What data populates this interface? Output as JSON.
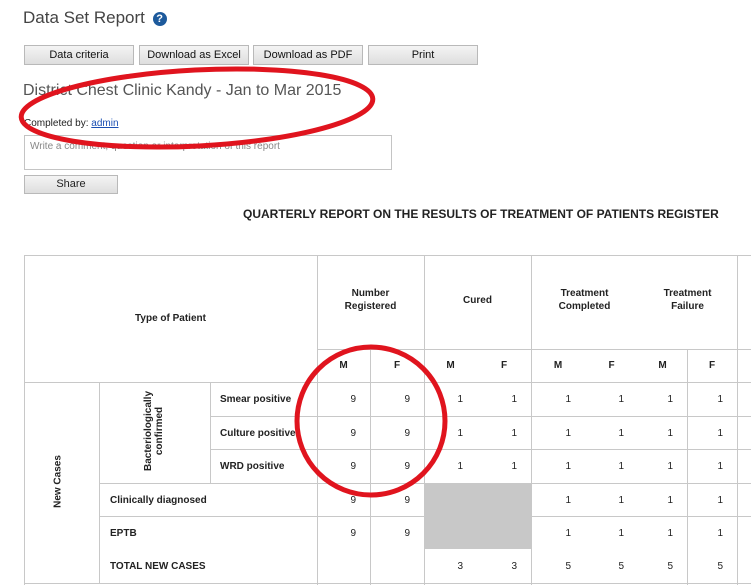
{
  "header": {
    "title": "Data Set Report",
    "help_icon": "?"
  },
  "toolbar": {
    "data_criteria": "Data criteria",
    "download_excel": "Download as Excel",
    "download_pdf": "Download as PDF",
    "print": "Print"
  },
  "report": {
    "title": "District Chest Clinic Kandy - Jan to Mar 2015",
    "completed_by_label": "Completed by:",
    "completed_by_user": "admin"
  },
  "comment": {
    "placeholder": "Write a comment, question or interpretation of this report",
    "share": "Share"
  },
  "table": {
    "title": "QUARTERLY REPORT ON THE RESULTS OF TREATMENT OF PATIENTS REGISTER",
    "type_header": "Type of Patient",
    "group_headers": [
      "Number Registered",
      "Cured",
      "Treatment Completed",
      "Treatment Failure"
    ],
    "sex_headers": [
      "M",
      "F",
      "M",
      "F",
      "M",
      "F",
      "M",
      "F"
    ],
    "new_cases": "New Cases",
    "bact": "Bacteriologically confirmed",
    "rows": [
      {
        "label": "Smear positive",
        "values": [
          "9",
          "9",
          "1",
          "1",
          "1",
          "1",
          "1",
          "1"
        ]
      },
      {
        "label": "Culture positive",
        "values": [
          "9",
          "9",
          "1",
          "1",
          "1",
          "1",
          "1",
          "1"
        ]
      },
      {
        "label": "WRD positive",
        "values": [
          "9",
          "9",
          "1",
          "1",
          "1",
          "1",
          "1",
          "1"
        ]
      },
      {
        "label": "Clinically diagnosed",
        "values": [
          "9",
          "9",
          "",
          "",
          "1",
          "1",
          "1",
          "1"
        ]
      },
      {
        "label": "EPTB",
        "values": [
          "9",
          "9",
          "",
          "",
          "1",
          "1",
          "1",
          "1"
        ]
      },
      {
        "label": "TOTAL NEW CASES",
        "values": [
          "",
          "",
          "3",
          "3",
          "5",
          "5",
          "5",
          "5"
        ]
      }
    ]
  },
  "colors": {
    "annotation": "#e0141e",
    "link": "#1b4fb3",
    "disabled_cell": "#c8c8c8"
  }
}
